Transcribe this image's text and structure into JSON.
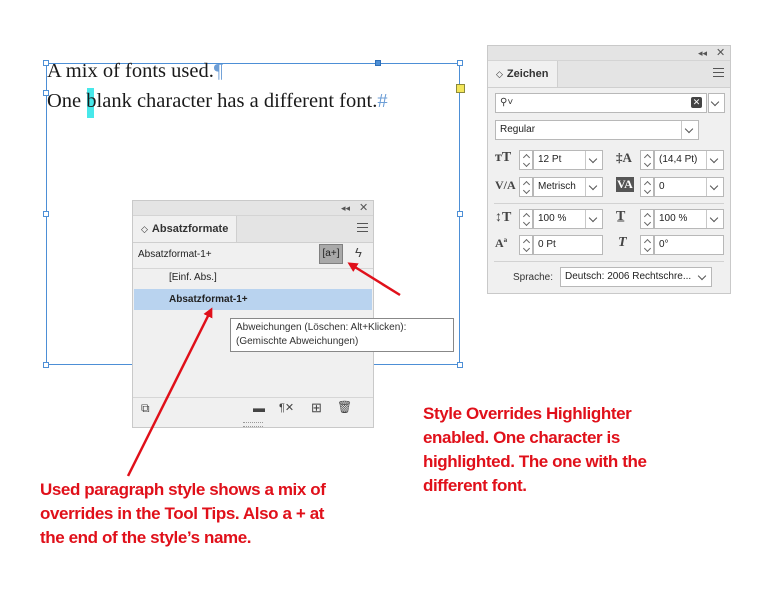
{
  "document": {
    "line1": "A mix of fonts used.",
    "line2_a": "One",
    "line2_b": "blank character has a different font.",
    "pilcrow": "¶",
    "end_of_story": "#"
  },
  "zeichen_panel": {
    "tab_label": "Zeichen",
    "font_family": "",
    "font_style": "Regular",
    "font_size": "12 Pt",
    "leading": "(14,4 Pt)",
    "kerning": "Metrisch",
    "tracking": "0",
    "vertical_scale": "100 %",
    "horizontal_scale": "100 %",
    "baseline_shift": "0 Pt",
    "skew": "0°",
    "language_label": "Sprache:",
    "language_value": "Deutsch: 2006 Rechtschre..."
  },
  "absatz_panel": {
    "tab_label": "Absatzformate",
    "current_style": "Absatzformat-1+",
    "override_button": "[a+]",
    "styles": [
      "[Einf. Abs.]",
      "Absatzformat-1+"
    ],
    "tooltip_line1": "Abweichungen (Löschen: Alt+Klicken):",
    "tooltip_line2": "(Gemischte Abweichungen)"
  },
  "annotations": {
    "right": [
      "Style Overrides Highlighter",
      "enabled. One character is",
      "highlighted. The one with the",
      "different font."
    ],
    "left": [
      "Used paragraph style shows a mix of",
      "overrides in the Tool Tips. Also a + at",
      "the end of the style’s name."
    ]
  },
  "colors": {
    "frame": "#4d8fd6",
    "highlight": "#47e8ea",
    "annotation": "#e0101a",
    "selection": "#b9d3ef"
  }
}
